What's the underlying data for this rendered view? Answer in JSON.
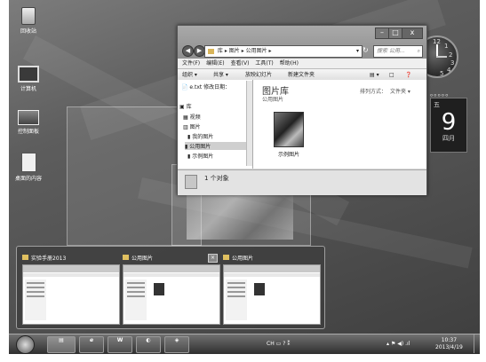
{
  "desktop_icons": [
    {
      "name": "recycle-bin-icon",
      "label": "回收站"
    },
    {
      "name": "computer-icon",
      "label": "计算机"
    },
    {
      "name": "control-panel-icon",
      "label": "控制面板"
    },
    {
      "name": "desktop-shortcut-icon",
      "label": "桌面的内容"
    }
  ],
  "clock_gadget": {
    "numbers": [
      "12",
      "1",
      "2",
      "3",
      "4",
      "5"
    ]
  },
  "calendar_gadget": {
    "weekday": "五",
    "day": "9",
    "month": "四月"
  },
  "explorer": {
    "window_controls": [
      "–",
      "□",
      "x"
    ],
    "address": [
      "库",
      "图片",
      "公用图片"
    ],
    "search_placeholder": "搜索 公用…",
    "menu": [
      "文件(F)",
      "编辑(E)",
      "查看(V)",
      "工具(T)",
      "帮助(H)"
    ],
    "commands": [
      "组织 ▾",
      "共享 ▾",
      "放映幻灯片",
      "新建文件夹"
    ],
    "nav_items": [
      "e.txt 修改日期：",
      "库",
      "视频",
      "图片",
      "我的图片",
      "公用图片",
      "示例图片"
    ],
    "library_title": "图片库",
    "library_subtitle": "公用图片",
    "arrange_label": "排列方式：",
    "arrange_value": "文件夹 ▾",
    "folder_label": "示例图片",
    "status": "1 个对象"
  },
  "switcher_thumbs": [
    {
      "title": "实验手册2013"
    },
    {
      "title": "公用图片"
    },
    {
      "title": "公用图片"
    }
  ],
  "taskbar": {
    "tray_text": "CH",
    "time": "10:37",
    "date": "2013/4/19"
  }
}
